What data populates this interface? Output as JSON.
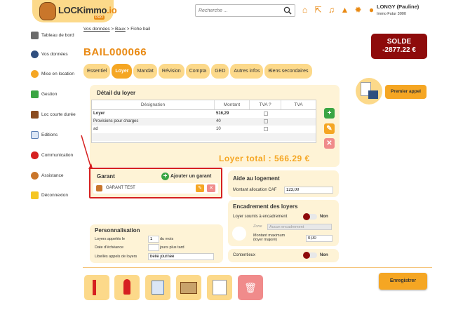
{
  "app": {
    "logo_text": "LOCKimmo",
    "logo_suffix": ".io",
    "logo_tag": "PRO"
  },
  "search": {
    "placeholder": "Recherche ..."
  },
  "user": {
    "name": "LONGY (Pauline)",
    "company": "Immo Futur 3000"
  },
  "sidebar": {
    "items": [
      {
        "label": "Tableau de bord",
        "icon": "dashboard-icon",
        "color": "#6b6b6b"
      },
      {
        "label": "Vos données",
        "icon": "person-icon",
        "color": "#2f4f7f"
      },
      {
        "label": "Mise en location",
        "icon": "key-bulb-icon",
        "color": "#f5a623"
      },
      {
        "label": "Gestion",
        "icon": "gestion-icon",
        "color": "#3aa543"
      },
      {
        "label": "Loc courte durée",
        "icon": "suitcase-icon",
        "color": "#8a4b1f"
      },
      {
        "label": "Editions",
        "icon": "document-icon",
        "color": "#5a7fb5"
      },
      {
        "label": "Communication",
        "icon": "chat-icon",
        "color": "#d62020"
      },
      {
        "label": "Assistance",
        "icon": "support-icon",
        "color": "#c9762b"
      },
      {
        "label": "Déconnexion",
        "icon": "logout-icon",
        "color": "#f5c623"
      }
    ]
  },
  "breadcrumb": {
    "a": "Vos données",
    "b": "Baux",
    "c": "Fiche bail",
    "sep": ">"
  },
  "page": {
    "title": "BAIL000066"
  },
  "solde": {
    "label": "SOLDE",
    "amount": "-2877.22 €"
  },
  "tabs": [
    {
      "label": "Essentiel"
    },
    {
      "label": "Loyer"
    },
    {
      "label": "Mandat"
    },
    {
      "label": "Révision"
    },
    {
      "label": "Compta"
    },
    {
      "label": "GED"
    },
    {
      "label": "Autres infos"
    },
    {
      "label": "Biens secondaires"
    }
  ],
  "premier_appel": "Premier appel",
  "loyer": {
    "title": "Détail du loyer",
    "headers": {
      "designation": "Désignation",
      "montant": "Montant",
      "tva_q": "TVA ?",
      "tva": "TVA"
    },
    "rows": [
      {
        "designation": "Loyer",
        "montant": "516,29"
      },
      {
        "designation": "Provisions pour charges",
        "montant": "40"
      },
      {
        "designation": "ad",
        "montant": "10"
      }
    ],
    "total": "Loyer total : 566.29 €"
  },
  "garant": {
    "title": "Garant",
    "add_label": "Ajouter un garant",
    "items": [
      {
        "name": "GARANT TEST"
      }
    ]
  },
  "aide": {
    "title": "Aide au logement",
    "field_label": "Montant allocation CAF",
    "field_value": "123,00"
  },
  "encadrement": {
    "title": "Encadrement des loyers",
    "soumis_label": "Loyer soumis à encadrement",
    "soumis_value": "Non",
    "zone_label": "Zone",
    "zone_value": "Aucun encadrement",
    "max_label": "Montant maximum (loyer majoré)",
    "max_value": "0,00"
  },
  "contentieux": {
    "label": "Contentieux",
    "value": "Non"
  },
  "perso": {
    "title": "Personnalisation",
    "loyers_appeles_label": "Loyers appelés le",
    "loyers_appeles_value": "1",
    "loyers_appeles_suffix": "du mois",
    "echeance_label": "Date d'échéance",
    "echeance_value": "",
    "echeance_suffix": "jours plus tard",
    "libelles_label": "Libellés appels de loyers",
    "libelles_value": "belle journée"
  },
  "actions": {
    "save": "Enregistrer"
  },
  "colors": {
    "accent": "#f5a623",
    "brand_light": "#fcd98a",
    "panel": "#fef3d6",
    "solde_bg": "#8e0b0b",
    "highlight": "#d62020",
    "green": "#3aa543"
  }
}
